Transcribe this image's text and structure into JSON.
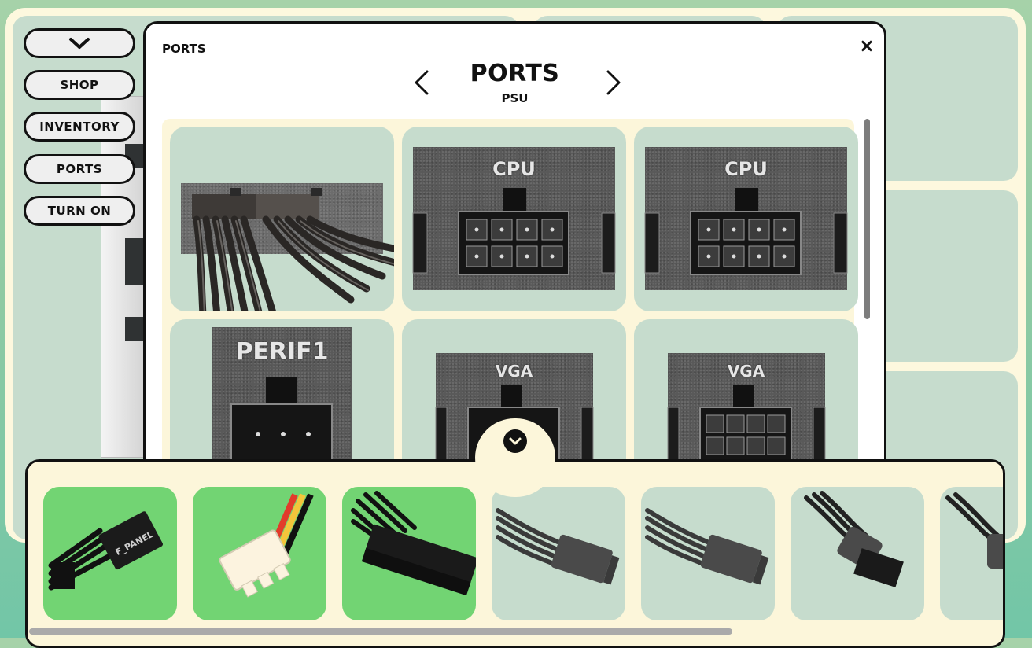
{
  "sidebar": {
    "toggle_icon": "chevron-down-icon",
    "buttons": [
      {
        "label": "SHOP"
      },
      {
        "label": "INVENTORY"
      },
      {
        "label": "PORTS"
      },
      {
        "label": "TURN ON"
      }
    ]
  },
  "modal": {
    "label": "PORTS",
    "close_symbol": "×",
    "title": "PORTS",
    "subtitle": "PSU",
    "prev_icon": "chevron-left-icon",
    "next_icon": "chevron-right-icon",
    "ports": [
      {
        "name": "connected-cables",
        "label": ""
      },
      {
        "name": "cpu-port",
        "label": "CPU"
      },
      {
        "name": "cpu-port",
        "label": "CPU"
      },
      {
        "name": "perif-port",
        "label": "PERIF1"
      },
      {
        "name": "vga-port",
        "label": "VGA"
      },
      {
        "name": "vga-port",
        "label": "VGA"
      }
    ]
  },
  "tray": {
    "expand_icon": "chevron-down-icon",
    "items": [
      {
        "name": "front-panel-cable",
        "label": "F_PANEL",
        "color": "#72d473"
      },
      {
        "name": "fan-3pin-cable",
        "color": "#72d473"
      },
      {
        "name": "atx-24pin-cable",
        "color": "#72d473"
      },
      {
        "name": "cpu-8pin-cable",
        "color": "#c6dccd"
      },
      {
        "name": "cpu-8pin-cable",
        "color": "#c6dccd"
      },
      {
        "name": "pcie-cable",
        "color": "#c6dccd"
      },
      {
        "name": "pcie-cable",
        "color": "#c6dccd"
      }
    ]
  },
  "colors": {
    "background_panel": "#c6dccd",
    "active_green": "#72d473",
    "cream": "#fcf6da",
    "border": "#111111"
  }
}
